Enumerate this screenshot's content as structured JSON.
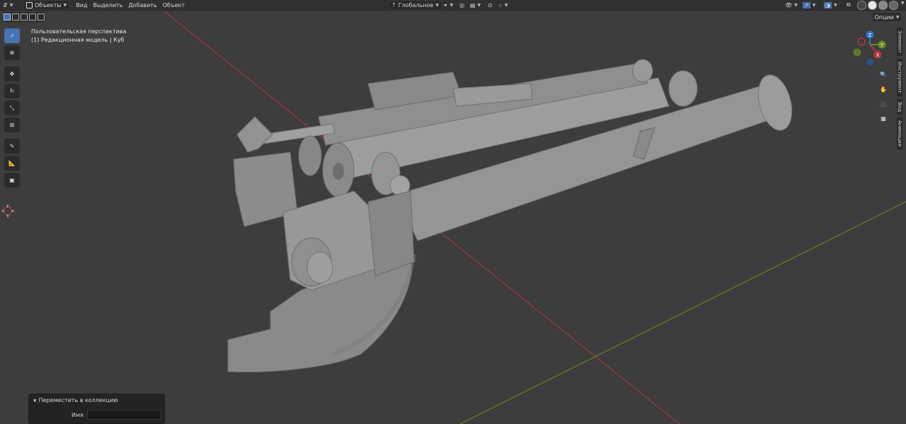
{
  "header": {
    "mode_label": "Объекты",
    "menus": [
      "Вид",
      "Выделить",
      "Добавить",
      "Объект"
    ],
    "transform_orientation": "Глобальное",
    "options_label": "Опции"
  },
  "viewport": {
    "perspective_label": "Пользовательская перспектива",
    "object_label": "(1) Редакционная модель | Куб",
    "axis_colors": {
      "x": "#b5353f",
      "y": "#6a8e22",
      "z": "#2f73c9"
    }
  },
  "gizmo": {
    "x_label": "X",
    "y_label": "Y",
    "z_label": "Z"
  },
  "side_tabs": [
    "Элемент",
    "Инструмент",
    "Вид",
    "Анимация"
  ],
  "toolbar": {
    "tools": [
      "select-box",
      "cursor",
      "move",
      "rotate",
      "scale",
      "transform",
      "annotate",
      "measure",
      "add-cube"
    ]
  },
  "last_operation": {
    "title": "Переместить в коллекцию",
    "name_label": "Имя",
    "name_value": ""
  }
}
